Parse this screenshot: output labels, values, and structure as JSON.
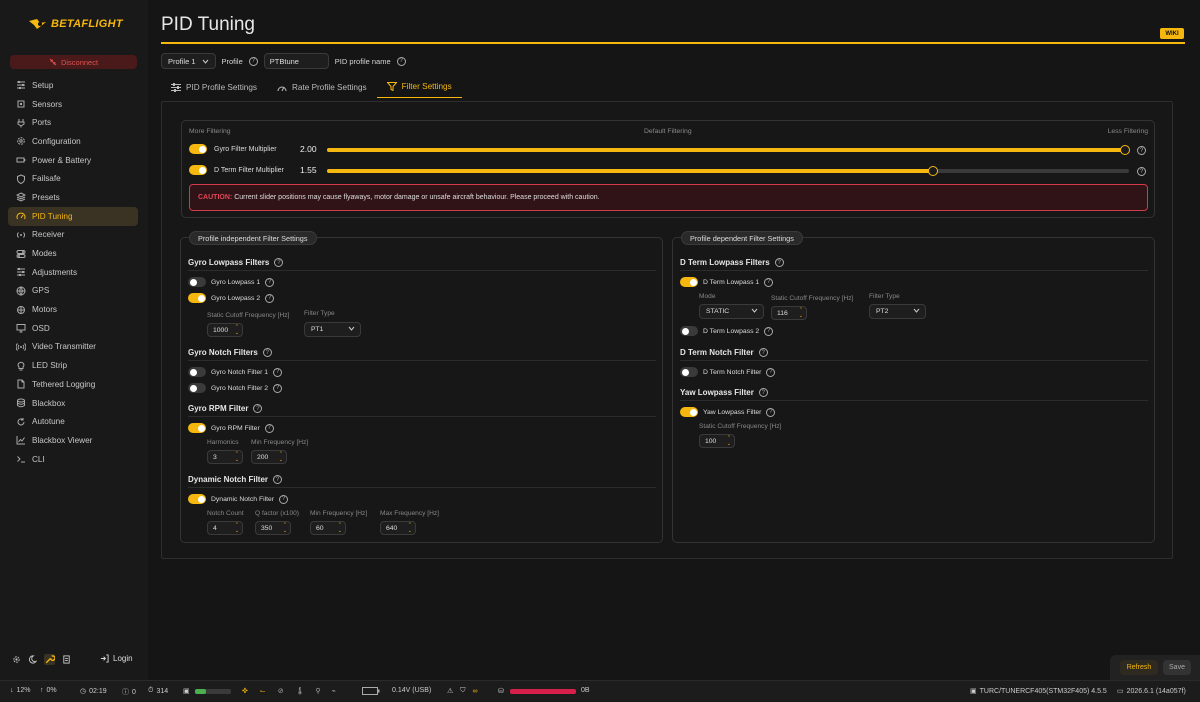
{
  "app": {
    "name": "BETAFLIGHT"
  },
  "sidebar": {
    "disconnect_label": "Disconnect",
    "items": [
      {
        "label": "Setup",
        "icon": "sliders-icon"
      },
      {
        "label": "Sensors",
        "icon": "chip-icon"
      },
      {
        "label": "Ports",
        "icon": "plug-icon"
      },
      {
        "label": "Configuration",
        "icon": "gear-icon"
      },
      {
        "label": "Power & Battery",
        "icon": "battery-icon"
      },
      {
        "label": "Failsafe",
        "icon": "shield-icon"
      },
      {
        "label": "Presets",
        "icon": "layers-icon"
      },
      {
        "label": "PID Tuning",
        "icon": "gauge-icon",
        "active": true
      },
      {
        "label": "Receiver",
        "icon": "antenna-icon"
      },
      {
        "label": "Modes",
        "icon": "toggles-icon"
      },
      {
        "label": "Adjustments",
        "icon": "sliders-icon"
      },
      {
        "label": "GPS",
        "icon": "globe-icon"
      },
      {
        "label": "Motors",
        "icon": "motor-icon"
      },
      {
        "label": "OSD",
        "icon": "monitor-icon"
      },
      {
        "label": "Video Transmitter",
        "icon": "broadcast-icon"
      },
      {
        "label": "LED Strip",
        "icon": "bulb-icon"
      },
      {
        "label": "Tethered Logging",
        "icon": "file-icon"
      },
      {
        "label": "Blackbox",
        "icon": "database-icon"
      },
      {
        "label": "Autotune",
        "icon": "refresh-icon"
      },
      {
        "label": "Blackbox Viewer",
        "icon": "chart-icon"
      },
      {
        "label": "CLI",
        "icon": "terminal-icon"
      }
    ],
    "login_label": "Login"
  },
  "header": {
    "title": "PID Tuning",
    "wiki_label": "WIKI",
    "profile_select": "Profile 1",
    "profile_label": "Profile",
    "profile_name_value": "PTBtune",
    "profile_name_label": "PID profile name"
  },
  "tabs": [
    {
      "label": "PID Profile Settings"
    },
    {
      "label": "Rate Profile Settings"
    },
    {
      "label": "Filter Settings",
      "active": true
    }
  ],
  "sliders": {
    "more_filtering": "More Filtering",
    "default_filtering": "Default Filtering",
    "less_filtering": "Less Filtering",
    "gyro": {
      "label": "Gyro Filter Multiplier",
      "value": "2.00",
      "fraction": 1.0,
      "enabled": true
    },
    "dterm": {
      "label": "D Term Filter Multiplier",
      "value": "1.55",
      "fraction": 0.76,
      "enabled": true
    },
    "caution_prefix": "CAUTION:",
    "caution_text": "Current slider positions may cause flyaways, motor damage or unsafe aircraft behaviour. Please proceed with caution."
  },
  "left_panel": {
    "title": "Profile independent Filter Settings",
    "gyro_lowpass": {
      "heading": "Gyro Lowpass Filters",
      "lp1": {
        "label": "Gyro Lowpass 1",
        "enabled": false
      },
      "lp2": {
        "label": "Gyro Lowpass 2",
        "enabled": true
      },
      "cutoff_label": "Static Cutoff Frequency [Hz]",
      "cutoff_value": "1000",
      "type_label": "Filter Type",
      "type_value": "PT1"
    },
    "gyro_notch": {
      "heading": "Gyro Notch Filters",
      "n1": {
        "label": "Gyro Notch Filter 1",
        "enabled": false
      },
      "n2": {
        "label": "Gyro Notch Filter 2",
        "enabled": false
      }
    },
    "gyro_rpm": {
      "heading": "Gyro RPM Filter",
      "toggle": {
        "label": "Gyro RPM Filter",
        "enabled": true
      },
      "harmonics_label": "Harmonics",
      "harmonics_value": "3",
      "minfreq_label": "Min Frequency [Hz]",
      "minfreq_value": "200"
    },
    "dyn_notch": {
      "heading": "Dynamic Notch Filter",
      "toggle": {
        "label": "Dynamic Notch Filter",
        "enabled": true
      },
      "count_label": "Notch Count",
      "count_value": "4",
      "q_label": "Q factor (x100)",
      "q_value": "350",
      "min_label": "Min Frequency [Hz]",
      "min_value": "60",
      "max_label": "Max Frequency [Hz]",
      "max_value": "640"
    }
  },
  "right_panel": {
    "title": "Profile dependent Filter Settings",
    "dterm_lowpass": {
      "heading": "D Term Lowpass Filters",
      "lp1": {
        "label": "D Term Lowpass 1",
        "enabled": true
      },
      "mode_label": "Mode",
      "mode_value": "STATIC",
      "cutoff_label": "Static Cutoff Frequency [Hz]",
      "cutoff_value": "116",
      "type_label": "Filter Type",
      "type_value": "PT2",
      "lp2": {
        "label": "D Term Lowpass 2",
        "enabled": false
      }
    },
    "dterm_notch": {
      "heading": "D Term Notch Filter",
      "toggle": {
        "label": "D Term Notch Filter",
        "enabled": false
      }
    },
    "yaw_lowpass": {
      "heading": "Yaw Lowpass Filter",
      "toggle": {
        "label": "Yaw Lowpass Filter",
        "enabled": true
      },
      "cutoff_label": "Static Cutoff Frequency [Hz]",
      "cutoff_value": "100"
    }
  },
  "actions": {
    "refresh_label": "Refresh",
    "save_label": "Save"
  },
  "status": {
    "down": "12%",
    "up": "0%",
    "time": "02:19",
    "errors": "0",
    "cycle": "314",
    "cpu_fraction": 0.3,
    "voltage": "0.14V (USB)",
    "storage": "0B",
    "firmware": "TURC/TUNERCF405(STM32F405) 4.5.5",
    "version": "2026.6.1 (14a057f)"
  },
  "colors": {
    "accent": "#f6b80e",
    "danger": "#d33a4a",
    "background": "#151515"
  }
}
